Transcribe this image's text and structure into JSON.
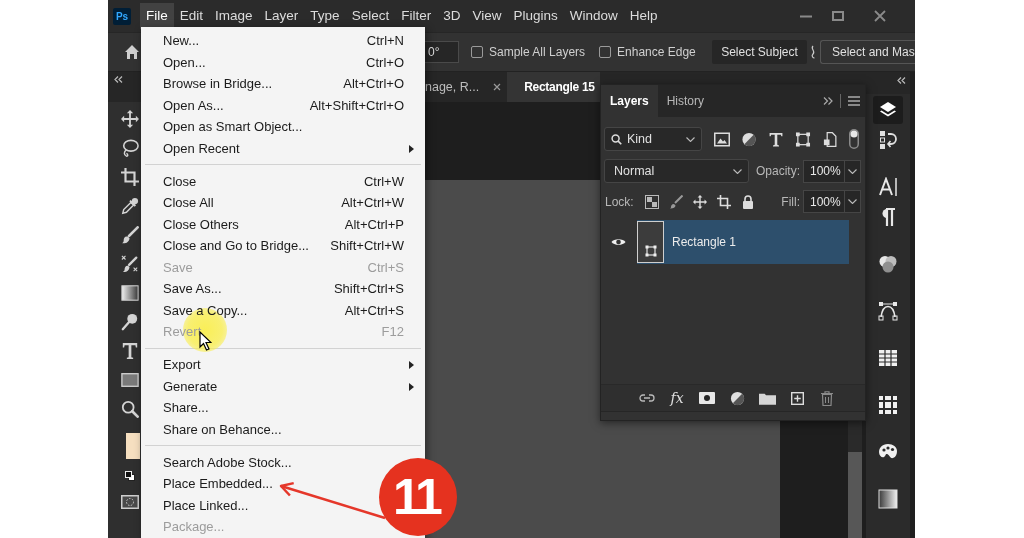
{
  "app": {
    "logo": "Ps"
  },
  "menu_bar": [
    {
      "label": "File",
      "selected": true
    },
    {
      "label": "Edit",
      "selected": false
    },
    {
      "label": "Image",
      "selected": false
    },
    {
      "label": "Layer",
      "selected": false
    },
    {
      "label": "Type",
      "selected": false
    },
    {
      "label": "Select",
      "selected": false
    },
    {
      "label": "Filter",
      "selected": false
    },
    {
      "label": "3D",
      "selected": false
    },
    {
      "label": "View",
      "selected": false
    },
    {
      "label": "Plugins",
      "selected": false
    },
    {
      "label": "Window",
      "selected": false
    },
    {
      "label": "Help",
      "selected": false
    }
  ],
  "options_bar": {
    "angle": "0°",
    "checkboxes": [
      {
        "label": "Sample All Layers",
        "checked": false
      },
      {
        "label": "Enhance Edge",
        "checked": false
      }
    ],
    "buttons": [
      {
        "label": "Select Subject",
        "kind": "filled"
      },
      {
        "label": "Select and Mas",
        "kind": "outlined"
      }
    ]
  },
  "document_tabs": [
    {
      "label": "nage, R...",
      "selected": false,
      "close_button": true
    },
    {
      "label": "Rectangle 15",
      "selected": true,
      "close_button": false
    }
  ],
  "file_menu": {
    "groups": [
      {
        "items": [
          {
            "label": "New...",
            "shortcut": "Ctrl+N",
            "disabled": false,
            "submenu": false
          },
          {
            "label": "Open...",
            "shortcut": "Ctrl+O",
            "disabled": false,
            "submenu": false
          },
          {
            "label": "Browse in Bridge...",
            "shortcut": "Alt+Ctrl+O",
            "disabled": false,
            "submenu": false
          },
          {
            "label": "Open As...",
            "shortcut": "Alt+Shift+Ctrl+O",
            "disabled": false,
            "submenu": false
          },
          {
            "label": "Open as Smart Object...",
            "disabled": false,
            "submenu": false
          },
          {
            "label": "Open Recent",
            "disabled": false,
            "submenu": true
          }
        ]
      },
      {
        "items": [
          {
            "label": "Close",
            "shortcut": "Ctrl+W",
            "disabled": false,
            "submenu": false
          },
          {
            "label": "Close All",
            "shortcut": "Alt+Ctrl+W",
            "disabled": false,
            "submenu": false
          },
          {
            "label": "Close Others",
            "shortcut": "Alt+Ctrl+P",
            "disabled": false,
            "submenu": false
          },
          {
            "label": "Close and Go to Bridge...",
            "shortcut": "Shift+Ctrl+W",
            "disabled": false,
            "submenu": false
          },
          {
            "label": "Save",
            "shortcut": "Ctrl+S",
            "disabled": true,
            "submenu": false
          },
          {
            "label": "Save As...",
            "shortcut": "Shift+Ctrl+S",
            "disabled": false,
            "submenu": false
          },
          {
            "label": "Save a Copy...",
            "shortcut": "Alt+Ctrl+S",
            "disabled": false,
            "submenu": false
          },
          {
            "label": "Revert",
            "shortcut": "F12",
            "disabled": true,
            "submenu": false
          }
        ]
      },
      {
        "items": [
          {
            "label": "Export",
            "disabled": false,
            "submenu": true
          },
          {
            "label": "Generate",
            "disabled": false,
            "submenu": true
          },
          {
            "label": "Share...",
            "disabled": false,
            "submenu": false
          },
          {
            "label": "Share on Behance...",
            "disabled": false,
            "submenu": false
          }
        ]
      },
      {
        "items": [
          {
            "label": "Search Adobe Stock...",
            "disabled": false,
            "submenu": false
          },
          {
            "label": "Place Embedded...",
            "disabled": false,
            "submenu": false
          },
          {
            "label": "Place Linked...",
            "disabled": false,
            "submenu": false
          },
          {
            "label": "Package...",
            "disabled": true,
            "submenu": false
          }
        ]
      }
    ]
  },
  "layers_panel": {
    "tabs": [
      {
        "label": "Layers",
        "selected": true
      },
      {
        "label": "History",
        "selected": false
      }
    ],
    "filter": "Kind",
    "blend_mode": "Normal",
    "opacity_label": "Opacity:",
    "opacity": "100%",
    "lock_label": "Lock:",
    "fill_label": "Fill:",
    "fill": "100%",
    "layers": [
      {
        "name": "Rectangle 1",
        "visible": true,
        "selected": true
      }
    ],
    "effects_button": "fx"
  },
  "annotation": {
    "number": "11"
  }
}
